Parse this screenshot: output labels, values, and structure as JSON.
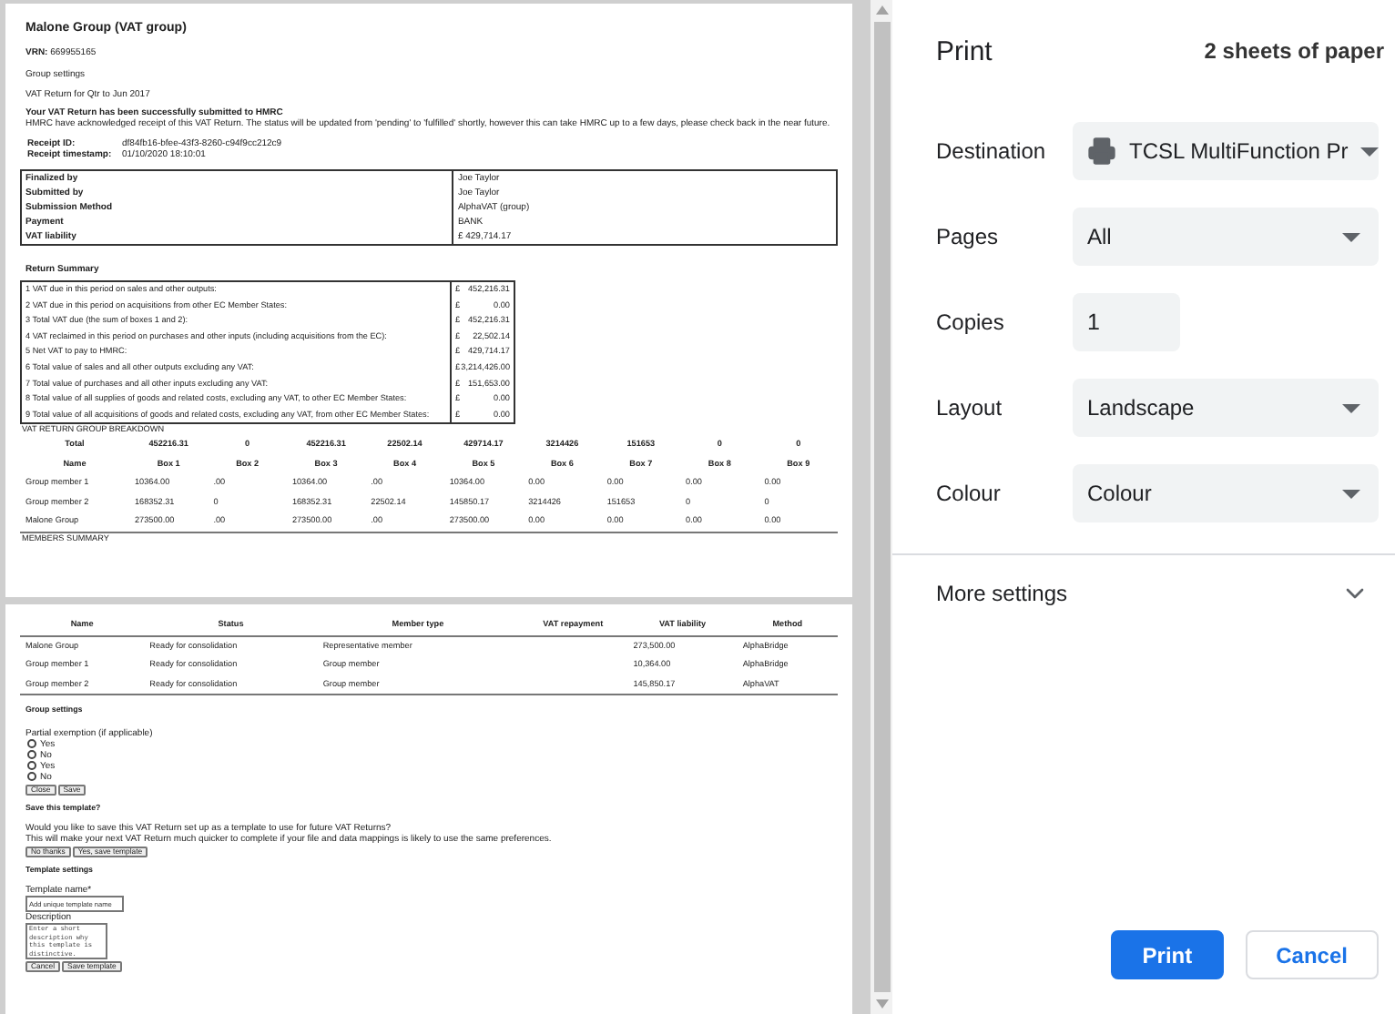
{
  "preview": {
    "page_1": {
      "title": "Malone Group (VAT group)",
      "vrn_label": "VRN:",
      "vrn": "669955165",
      "group_settings": "Group settings",
      "period": "VAT Return for Qtr to Jun 2017",
      "success_title": "Your VAT Return has been successfully submitted to HMRC",
      "success_text": "HMRC have acknowledged receipt of this VAT Return. The status will be updated from 'pending' to 'fulfilled' shortly, however this can take HMRC up to a few days, please check back in the near future.",
      "receipt": [
        {
          "label": "Receipt ID:",
          "value": "df84fb16-bfee-43f3-8260-c94f9cc212c9"
        },
        {
          "label": "Receipt timestamp:",
          "value": "01/10/2020 18:10:01"
        }
      ],
      "details": [
        {
          "label": "Finalized by",
          "value": "Joe Taylor"
        },
        {
          "label": "Submitted by",
          "value": "Joe Taylor"
        },
        {
          "label": "Submission Method",
          "value": "AlphaVAT (group)"
        },
        {
          "label": "Payment",
          "value": "BANK"
        },
        {
          "label": "VAT liability",
          "value": "£ 429,714.17"
        }
      ],
      "summary_title": "Return Summary",
      "summary": [
        {
          "label": "1 VAT due in this period on sales and other outputs:",
          "currency": "£",
          "amount": "452,216.31"
        },
        {
          "label": "2 VAT due in this period on acquisitions from other EC Member States:",
          "currency": "£",
          "amount": "0.00"
        },
        {
          "label": "3 Total VAT due (the sum of boxes 1 and 2):",
          "currency": "£",
          "amount": "452,216.31"
        },
        {
          "label": "4 VAT reclaimed in this period on purchases and other inputs (including acquisitions from the EC):",
          "currency": "£",
          "amount": "22,502.14"
        },
        {
          "label": "5 Net VAT to pay to HMRC:",
          "currency": "£",
          "amount": "429,714.17"
        },
        {
          "label": "6 Total value of sales and all other outputs excluding any VAT:",
          "currency": "£",
          "amount": "3,214,426.00"
        },
        {
          "label": "7 Total value of purchases and all other inputs excluding any VAT:",
          "currency": "£",
          "amount": "151,653.00"
        },
        {
          "label": "8 Total value of all supplies of goods and related costs, excluding any VAT, to other EC Member States:",
          "currency": "£",
          "amount": "0.00"
        },
        {
          "label": "9 Total value of all acquisitions of goods and related costs, excluding any VAT, from other EC Member States:",
          "currency": "£",
          "amount": "0.00"
        }
      ],
      "breakdown_title": "VAT RETURN GROUP BREAKDOWN",
      "breakdown_total": [
        "Total",
        "452216.31",
        "0",
        "452216.31",
        "22502.14",
        "429714.17",
        "3214426",
        "151653",
        "0",
        "0"
      ],
      "breakdown_columns": [
        "Name",
        "Box 1",
        "Box 2",
        "Box 3",
        "Box 4",
        "Box 5",
        "Box 6",
        "Box 7",
        "Box 8",
        "Box 9"
      ],
      "breakdown_rows": [
        [
          "Group member 1",
          "10364.00",
          ".00",
          "10364.00",
          ".00",
          "10364.00",
          "0.00",
          "0.00",
          "0.00",
          "0.00"
        ],
        [
          "Group member 2",
          "168352.31",
          "0",
          "168352.31",
          "22502.14",
          "145850.17",
          "3214426",
          "151653",
          "0",
          "0"
        ],
        [
          "Malone Group",
          "273500.00",
          ".00",
          "273500.00",
          ".00",
          "273500.00",
          "0.00",
          "0.00",
          "0.00",
          "0.00"
        ]
      ],
      "members_title": "MEMBERS SUMMARY"
    },
    "page_2": {
      "members_columns": [
        "Name",
        "Status",
        "Member type",
        "VAT repayment",
        "VAT liability",
        "Method"
      ],
      "members_rows": [
        {
          "name": "Malone Group",
          "status": "Ready for consolidation",
          "member_type": "Representative member",
          "vat_liability": "273,500.00",
          "method": "AlphaBridge"
        },
        {
          "name": "Group member 1",
          "status": "Ready for consolidation",
          "member_type": "Group member",
          "vat_liability": "10,364.00",
          "method": "AlphaBridge"
        },
        {
          "name": "Group member 2",
          "status": "Ready for consolidation",
          "member_type": "Group member",
          "vat_liability": "145,850.17",
          "method": "AlphaVAT"
        }
      ],
      "group_settings_title": "Group settings",
      "partial_exemption_label": "Partial exemption (if applicable)",
      "partial_exemption_options": [
        {
          "label": "Yes",
          "selected": false
        },
        {
          "label": "No",
          "selected": false
        },
        {
          "label": "Yes",
          "selected": false
        },
        {
          "label": "No",
          "selected": false
        }
      ],
      "group_buttons": [
        "Close",
        "Save"
      ],
      "save_template_title": "Save this template?",
      "save_template_text": [
        "Would you like to save this VAT Return set up as a template to use for future VAT Returns?",
        "This will make your next VAT Return much quicker to complete if your file and data mappings is likely to use the same preferences."
      ],
      "save_template_buttons": [
        "No thanks",
        "Yes, save template"
      ],
      "template_settings_title": "Template settings",
      "template_name_label": "Template name*",
      "template_name_placeholder": "Add unique template name",
      "description_label": "Description",
      "description_placeholder": "Enter a short description why this template is distinctive.",
      "template_buttons": [
        "Cancel",
        "Save template"
      ]
    }
  },
  "print_panel": {
    "title": "Print",
    "sheets": "2 sheets of paper",
    "settings": [
      {
        "label": "Destination",
        "kind": "destination",
        "value": "TCSL MultiFunction Pr"
      },
      {
        "label": "Pages",
        "kind": "select",
        "value": "All"
      },
      {
        "label": "Copies",
        "kind": "number",
        "value": "1"
      },
      {
        "label": "Layout",
        "kind": "select",
        "value": "Landscape"
      },
      {
        "label": "Colour",
        "kind": "select",
        "value": "Colour"
      }
    ],
    "more_settings": "More settings",
    "buttons": [
      {
        "label": "Print",
        "kind": "primary"
      },
      {
        "label": "Cancel",
        "kind": "secondary"
      }
    ]
  }
}
